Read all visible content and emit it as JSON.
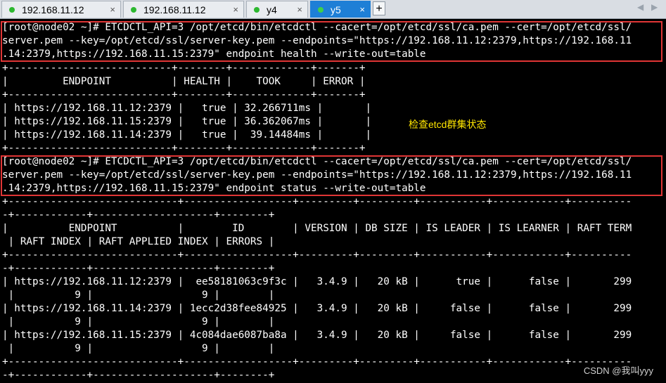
{
  "tabs": [
    {
      "label": "192.168.11.12",
      "close": "×"
    },
    {
      "label": "192.168.11.12",
      "close": "×"
    },
    {
      "label": "y4",
      "close": "×"
    },
    {
      "label": "y5",
      "close": "×"
    }
  ],
  "add_tab_label": "+",
  "nav": {
    "prev": "◀",
    "next": "▶"
  },
  "terminal": {
    "lines": [
      "[root@node02 ~]# ETCDCTL_API=3 /opt/etcd/bin/etcdctl --cacert=/opt/etcd/ssl/ca.pem --cert=/opt/etcd/ssl/",
      "server.pem --key=/opt/etcd/ssl/server-key.pem --endpoints=\"https://192.168.11.12:2379,https://192.168.11",
      ".14:2379,https://192.168.11.15:2379\" endpoint health --write-out=table",
      "+---------------------------+--------+-------------+-------+",
      "|         ENDPOINT          | HEALTH |    TOOK     | ERROR |",
      "+---------------------------+--------+-------------+-------+",
      "| https://192.168.11.12:2379 |   true | 32.266711ms |       |",
      "| https://192.168.11.15:2379 |   true | 36.362067ms |       |",
      "| https://192.168.11.14:2379 |   true |  39.14484ms |       |",
      "+---------------------------+--------+-------------+-------+",
      "[root@node02 ~]# ETCDCTL_API=3 /opt/etcd/bin/etcdctl --cacert=/opt/etcd/ssl/ca.pem --cert=/opt/etcd/ssl/",
      "server.pem --key=/opt/etcd/ssl/server-key.pem --endpoints=\"https://192.168.11.12:2379,https://192.168.11",
      ".14:2379,https://192.168.11.15:2379\" endpoint status --write-out=table",
      "+----------------------------+------------------+---------+---------+-----------+------------+----------",
      "-+------------+--------------------+--------+",
      "|          ENDPOINT          |        ID        | VERSION | DB SIZE | IS LEADER | IS LEARNER | RAFT TERM",
      " | RAFT INDEX | RAFT APPLIED INDEX | ERRORS |",
      "+----------------------------+------------------+---------+---------+-----------+------------+----------",
      "-+------------+--------------------+--------+",
      "| https://192.168.11.12:2379 |  ee58181063c9f3c |   3.4.9 |   20 kB |      true |      false |       299",
      " |          9 |                  9 |        |",
      "| https://192.168.11.14:2379 | 1ecc2d38fee84925 |   3.4.9 |   20 kB |     false |      false |       299",
      " |          9 |                  9 |        |",
      "| https://192.168.11.15:2379 | 4c084dae6087ba8a |   3.4.9 |   20 kB |     false |      false |       299",
      " |          9 |                  9 |        |",
      "+----------------------------+------------------+---------+---------+-----------+------------+----------",
      "-+------------+--------------------+--------+"
    ],
    "annotation": "检查etcd群集状态",
    "watermark": "CSDN @我叫yyy"
  },
  "colors": {
    "highlight_box": "#e03535",
    "annotation": "#ffe600",
    "active_tab": "#1e7fd6",
    "tab_dot": "#2db830"
  }
}
